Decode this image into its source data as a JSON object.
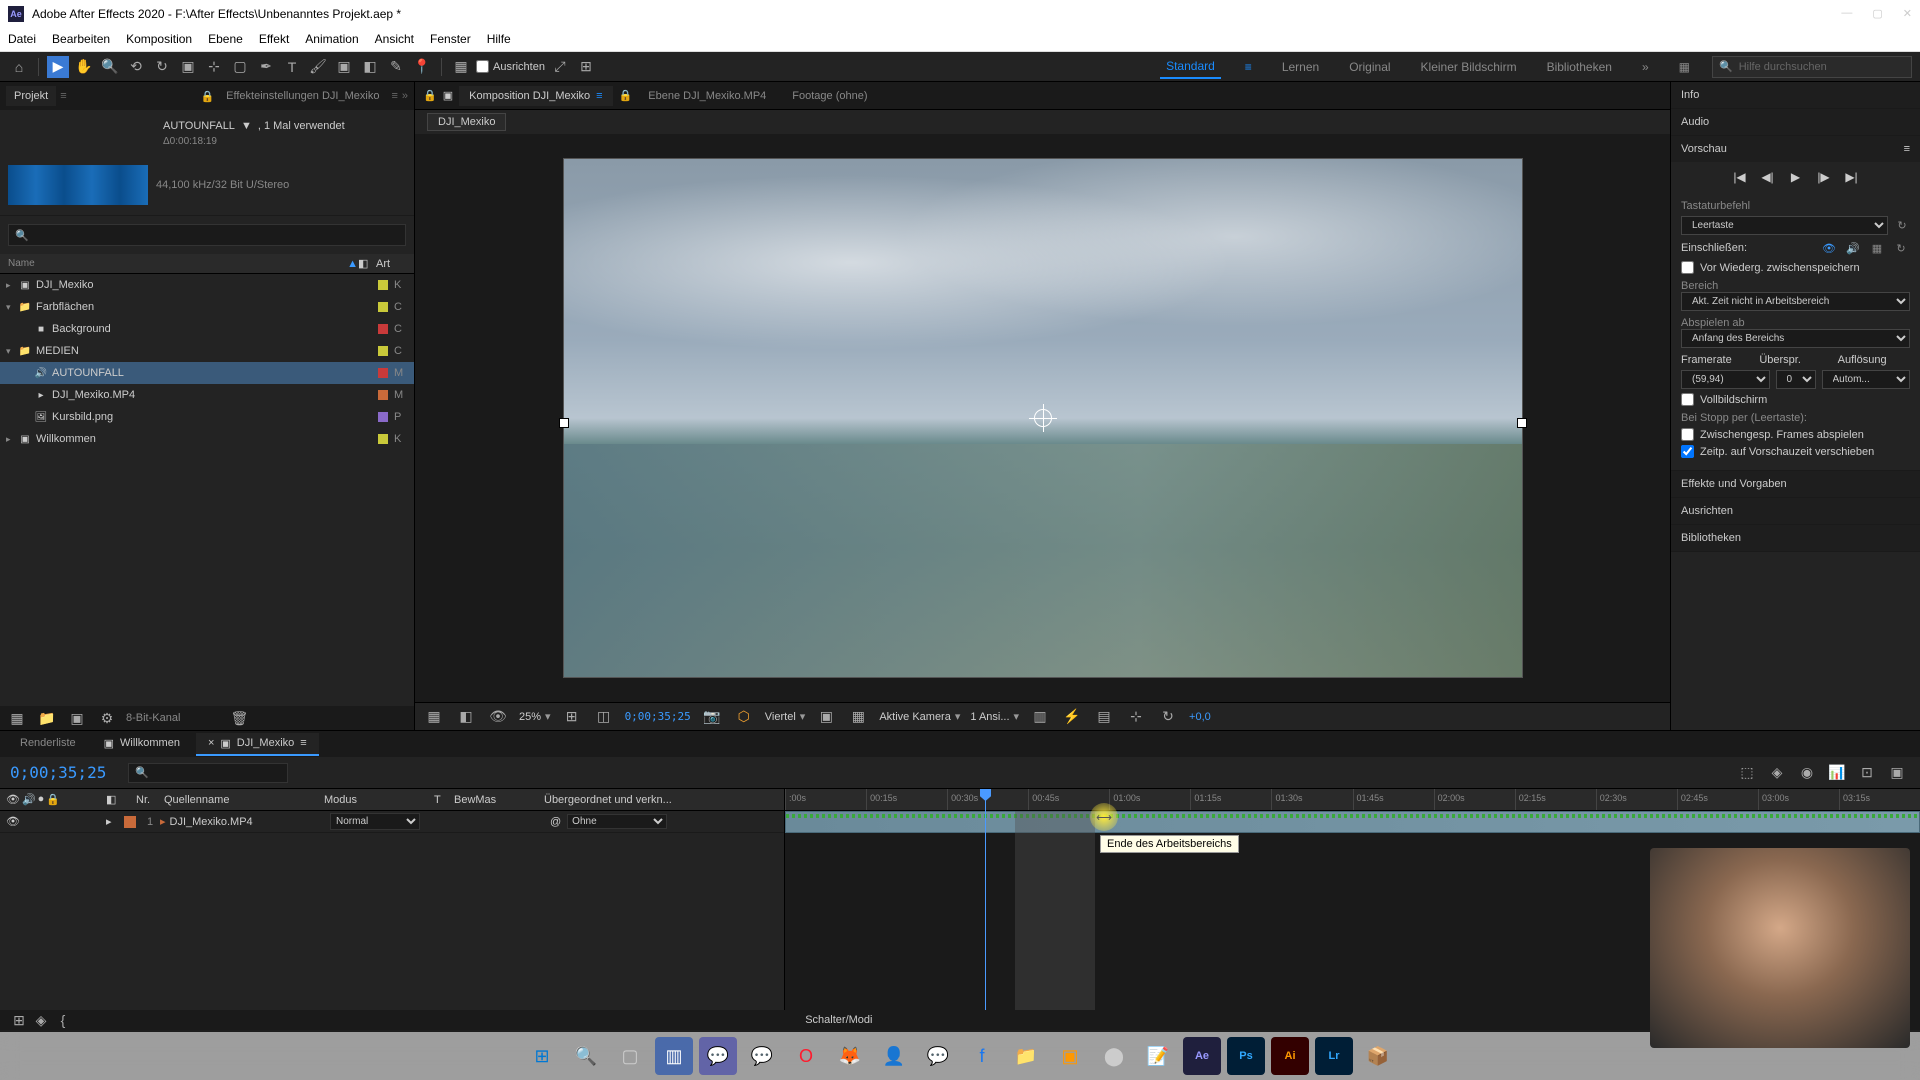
{
  "titlebar": {
    "title": "Adobe After Effects 2020 - F:\\After Effects\\Unbenanntes Projekt.aep *"
  },
  "menubar": [
    "Datei",
    "Bearbeiten",
    "Komposition",
    "Ebene",
    "Effekt",
    "Animation",
    "Ansicht",
    "Fenster",
    "Hilfe"
  ],
  "toolbar": {
    "align_label": "Ausrichten",
    "search_placeholder": "Hilfe durchsuchen"
  },
  "workspaces": {
    "items": [
      "Standard",
      "Lernen",
      "Original",
      "Kleiner Bildschirm",
      "Bibliotheken"
    ],
    "active": "Standard"
  },
  "project_panel": {
    "tab_project": "Projekt",
    "tab_effect": "Effekteinstellungen DJI_Mexiko",
    "asset_name": "AUTOUNFALL",
    "asset_usage": ", 1 Mal verwendet",
    "asset_duration": "Δ0:00:18:19",
    "asset_audio": "44,100 kHz/32 Bit U/Stereo",
    "col_name": "Name",
    "col_art": "Art",
    "items": [
      {
        "name": "DJI_Mexiko",
        "type": "comp",
        "color": "#c9c93a",
        "art": "K",
        "indent": 0
      },
      {
        "name": "Farbflächen",
        "type": "folder",
        "color": "#c9c93a",
        "art": "C",
        "indent": 0,
        "expanded": true
      },
      {
        "name": "Background",
        "type": "solid",
        "color": "#c93a3a",
        "art": "C",
        "indent": 1
      },
      {
        "name": "MEDIEN",
        "type": "folder",
        "color": "#c9c93a",
        "art": "C",
        "indent": 0,
        "expanded": true
      },
      {
        "name": "AUTOUNFALL",
        "type": "audio",
        "color": "#c93a3a",
        "art": "M",
        "indent": 1,
        "selected": true
      },
      {
        "name": "DJI_Mexiko.MP4",
        "type": "video",
        "color": "#c96a3a",
        "art": "M",
        "indent": 1
      },
      {
        "name": "Kursbild.png",
        "type": "image",
        "color": "#8a6ac9",
        "art": "P",
        "indent": 1
      },
      {
        "name": "Willkommen",
        "type": "comp",
        "color": "#c9c93a",
        "art": "K",
        "indent": 0
      }
    ],
    "footer_bits": "8-Bit-Kanal"
  },
  "comp_panel": {
    "tab_comp": "Komposition DJI_Mexiko",
    "tab_layer": "Ebene DJI_Mexiko.MP4",
    "tab_footage": "Footage (ohne)",
    "flowpath": "DJI_Mexiko"
  },
  "viewer": {
    "zoom": "25%",
    "timecode": "0;00;35;25",
    "resolution": "Viertel",
    "camera": "Aktive Kamera",
    "views": "1 Ansi...",
    "exposure": "+0,0"
  },
  "right_panel": {
    "info": "Info",
    "audio": "Audio",
    "vorschau": "Vorschau",
    "tastatur": "Tastaturbefehl",
    "shortcut": "Leertaste",
    "einschliessen": "Einschließen:",
    "cache_before": "Vor Wiederg. zwischenspeichern",
    "bereich": "Bereich",
    "bereich_value": "Akt. Zeit nicht in Arbeitsbereich",
    "abspielen": "Abspielen ab",
    "abspielen_value": "Anfang des Bereichs",
    "framerate": "Framerate",
    "framerate_value": "(59,94)",
    "skip": "Überspr.",
    "skip_value": "0",
    "aufloesung": "Auflösung",
    "aufloesung_value": "Autom...",
    "vollbild": "Vollbildschirm",
    "stop_per": "Bei Stopp per (Leertaste):",
    "cache_frames": "Zwischengesp. Frames abspielen",
    "move_time": "Zeitp. auf Vorschauzeit verschieben",
    "effekte": "Effekte und Vorgaben",
    "ausrichten": "Ausrichten",
    "bibliotheken": "Bibliotheken"
  },
  "timeline": {
    "tab_render": "Renderliste",
    "tab_welcome": "Willkommen",
    "tab_comp": "DJI_Mexiko",
    "timecode": "0;00;35;25",
    "cols": {
      "nr": "Nr.",
      "quelle": "Quellenname",
      "modus": "Modus",
      "t": "T",
      "bewmas": "BewMas",
      "parent": "Übergeordnet und verkn..."
    },
    "layer": {
      "num": "1",
      "name": "DJI_Mexiko.MP4",
      "mode": "Normal",
      "parent": "Ohne"
    },
    "ruler": [
      ":00s",
      "00:15s",
      "00:30s",
      "00:45s",
      "01:00s",
      "01:15s",
      "01:30s",
      "01:45s",
      "02:00s",
      "02:15s",
      "02:30s",
      "02:45s",
      "03:00s",
      "03:15s"
    ],
    "tooltip": "Ende des Arbeitsbereichs",
    "footer": "Schalter/Modi"
  }
}
